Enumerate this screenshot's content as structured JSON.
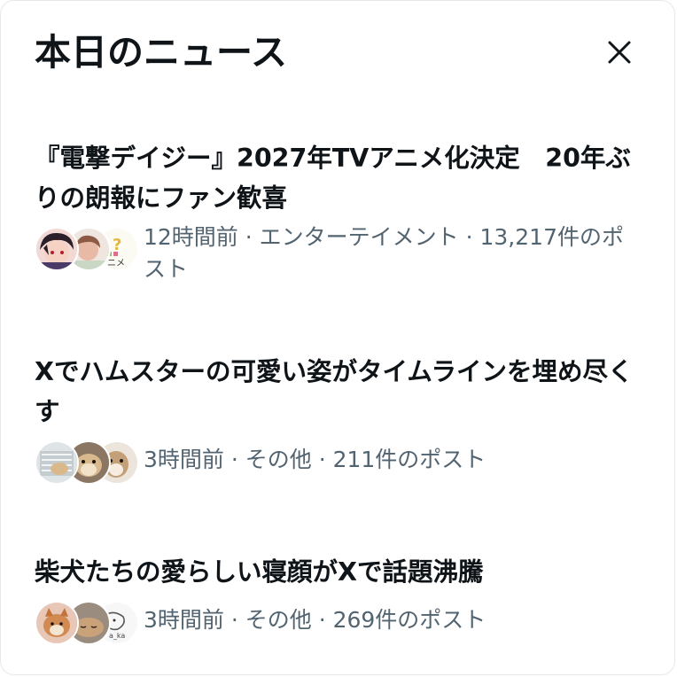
{
  "header": {
    "title": "本日のニュース",
    "close_icon": "close-icon"
  },
  "colors": {
    "title_text": "#0f1419",
    "meta_text": "#536471",
    "divider": "#e6e9eb"
  },
  "news": [
    {
      "title": "『電撃デイジー』2027年TVアニメ化決定　20年ぶりの朗報にファン歓喜",
      "meta": "12時間前 · エンターテイメント · 13,217件のポスト",
      "avatars": [
        "anime-character-avatar",
        "illustration-avatar",
        "anime-logo-avatar"
      ]
    },
    {
      "title": "Xでハムスターの可愛い姿がタイムラインを埋め尽くす",
      "meta": "3時間前 · その他 · 211件のポスト",
      "avatars": [
        "hamster-cage-avatar",
        "hamster-avatar",
        "hamster-closeup-avatar"
      ]
    },
    {
      "title": "柴犬たちの愛らしい寝顔がXで話題沸騰",
      "meta": "3時間前 · その他 · 269件のポスト",
      "avatars": [
        "shiba-dog-avatar",
        "sleeping-dog-avatar",
        "sketch-avatar"
      ]
    }
  ]
}
